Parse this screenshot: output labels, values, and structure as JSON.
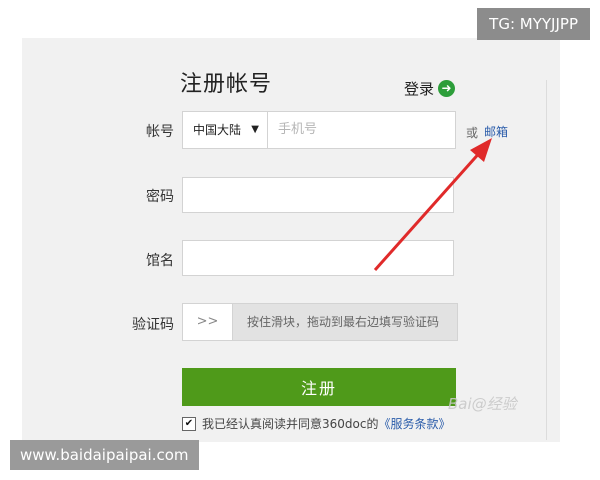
{
  "overlay": {
    "tag": "TG: MYYJJPP",
    "url": "www.baidaipaipai.com",
    "watermark": "Bai@经验"
  },
  "form": {
    "title": "注册帐号",
    "login_link": "登录",
    "account_label": "帐号",
    "region_value": "中国大陆",
    "phone_placeholder": "手机号",
    "or_text": "或",
    "email_link": "邮箱",
    "password_label": "密码",
    "nickname_label": "馆名",
    "captcha_label": "验证码",
    "slider_handle": ">>",
    "slider_text": "按住滑块，拖动到最右边填写验证码",
    "register_button": "注册",
    "agree_text": "我已经认真阅读并同意360doc的",
    "terms_link": "《服务条款》"
  },
  "colors": {
    "accent_green": "#4f9a1a",
    "link_blue": "#2a5caa",
    "arrow_red": "#e02a2a"
  }
}
